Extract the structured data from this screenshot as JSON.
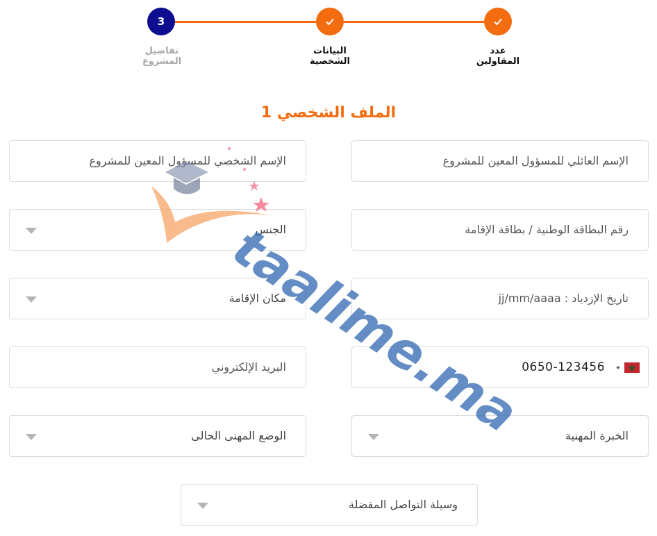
{
  "stepper": {
    "steps": [
      {
        "label": "عدد\nالمقاولين",
        "state": "done"
      },
      {
        "label": "البيانات\nالشخصية",
        "state": "done"
      },
      {
        "label": "تفاصيل\nالمشروع",
        "state": "current",
        "number": "3"
      }
    ]
  },
  "section": {
    "title": "الملف الشخصي 1"
  },
  "form": {
    "family_name": "الإسم العائلي  للمسؤول المعين للمشروع",
    "first_name": "الإسم الشخصي للمسؤول المعين للمشروع",
    "id_card": "رقم البطاقة الوطنية / بطاقة الإقامة",
    "gender": "الجنس",
    "birth_date": "تاريخ الإزدياد : jj/mm/aaaa",
    "residence": "مكان الإقامة",
    "phone": "0650-123456",
    "email": "البريد الإلكتروني",
    "experience": "الخبرة المهنية",
    "current_status": "الوضع المهنى الحالى",
    "contact_method": "وسيلة التواصل المفضلة"
  },
  "watermark": {
    "text": "taalime.ma"
  },
  "colors": {
    "accent": "#f36c10",
    "current_step": "#0d0e8f",
    "border": "#dcdcdc"
  }
}
